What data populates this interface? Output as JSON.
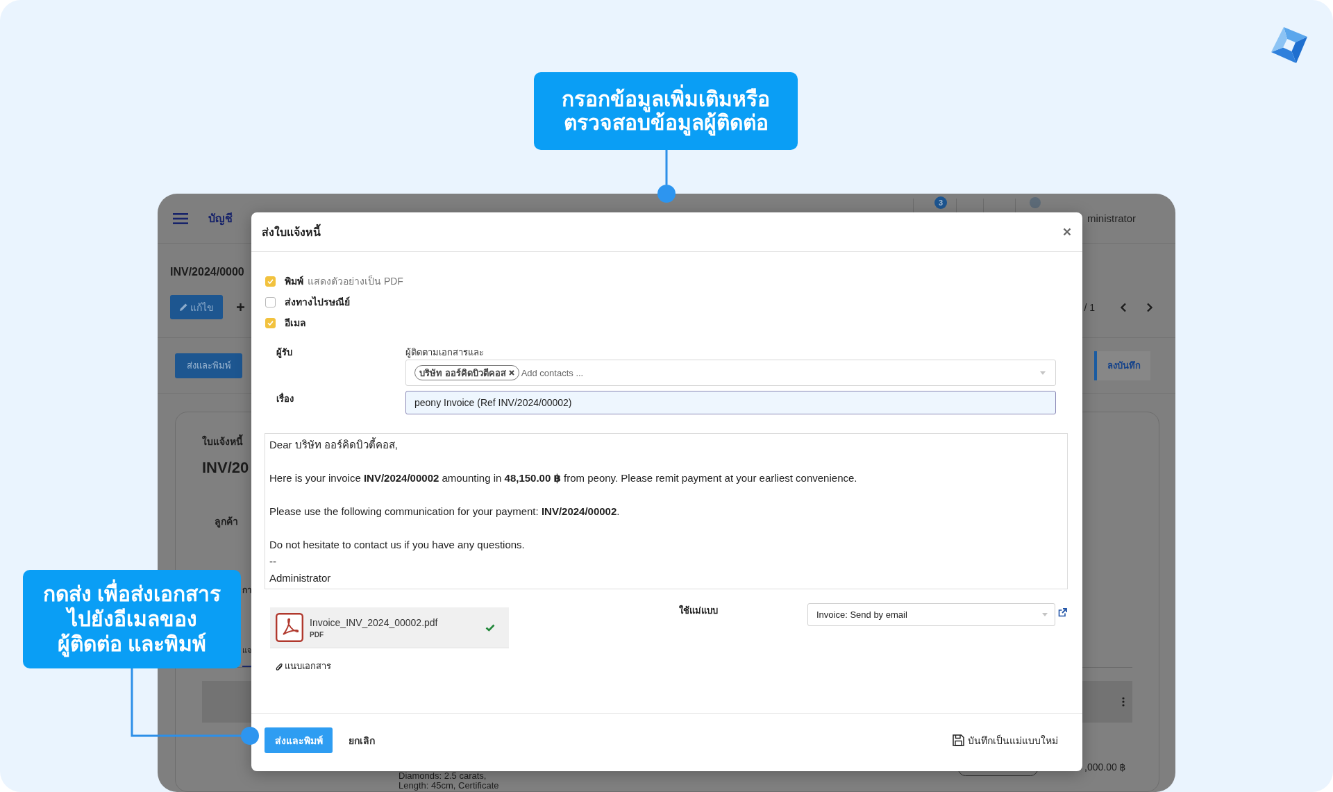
{
  "callouts": [
    {
      "kind": "top",
      "lines": [
        "กรอกข้อมูลเพิ่มเติมหรือ",
        "ตรวจสอบข้อมูลผู้ติดต่อ"
      ]
    },
    {
      "kind": "left",
      "lines": [
        "กดส่ง เพื่อส่งเอกสาร",
        "ไปยังอีเมลของ",
        "ผู้ติดต่อ และพิมพ์"
      ]
    }
  ],
  "app": {
    "module_title": "บัญชี",
    "notification_count": "3",
    "user_name": "ministrator",
    "record_title": "INV/2024/0000",
    "edit_button": "แก้ไข",
    "pager": "/ 1",
    "send_print_button": "ส่งและพิมพ์",
    "log_note_button": "ลงบันทึก",
    "card": {
      "doc_type": "ใบแจ้งหนี้",
      "doc_number": "INV/20",
      "customer_label": "ลูกค้า",
      "field_label": "กา",
      "tabs": [
        {
          "label": "แจ",
          "selected": true
        }
      ],
      "line_description": [
        "Diamonds: 2.5 carats,",
        "Length: 45cm, Certificate"
      ],
      "line_amount": ",000.00 ฿"
    }
  },
  "dialog": {
    "title": "ส่งใบแจ้งหนี้",
    "options": [
      {
        "label": "พิมพ์",
        "hint": "แสดงตัวอย่างเป็น PDF",
        "checked": true
      },
      {
        "label": "ส่งทางไปรษณีย์",
        "checked": false
      },
      {
        "label": "อีเมล",
        "checked": true
      }
    ],
    "recipients": {
      "label": "ผู้รับ",
      "note": "ผู้ติดตามเอกสารและ",
      "tags": [
        "บริษัท ออร์คิดบิวตีคอส"
      ],
      "placeholder": "Add contacts ..."
    },
    "subject": {
      "label": "เรื่อง",
      "value": "peony Invoice (Ref INV/2024/00002)"
    },
    "body": {
      "paragraphs": [
        [
          "Dear บริษัท ออร์คิดบิวตี้คอส,"
        ],
        [
          "Here is your invoice **INV/2024/00002** amounting in **48,150.00 ฿** from peony. Please remit payment at your earliest convenience."
        ],
        [
          "Please use the following communication for your payment: **INV/2024/00002**."
        ],
        [
          "Do not hesitate to contact us if you have any questions.",
          "--",
          "Administrator"
        ]
      ]
    },
    "attachments": [
      {
        "name": "Invoice_INV_2024_00002.pdf",
        "type": "PDF",
        "uploaded": true
      }
    ],
    "attach_link": "แนบเอกสาร",
    "template": {
      "label": "ใช้แม่แบบ",
      "value": "Invoice: Send by email"
    },
    "footer": {
      "send_button": "ส่งและพิมพ์",
      "cancel_button": "ยกเลิก",
      "save_template_button": "บันทึกเป็นแม่แบบใหม่"
    }
  }
}
